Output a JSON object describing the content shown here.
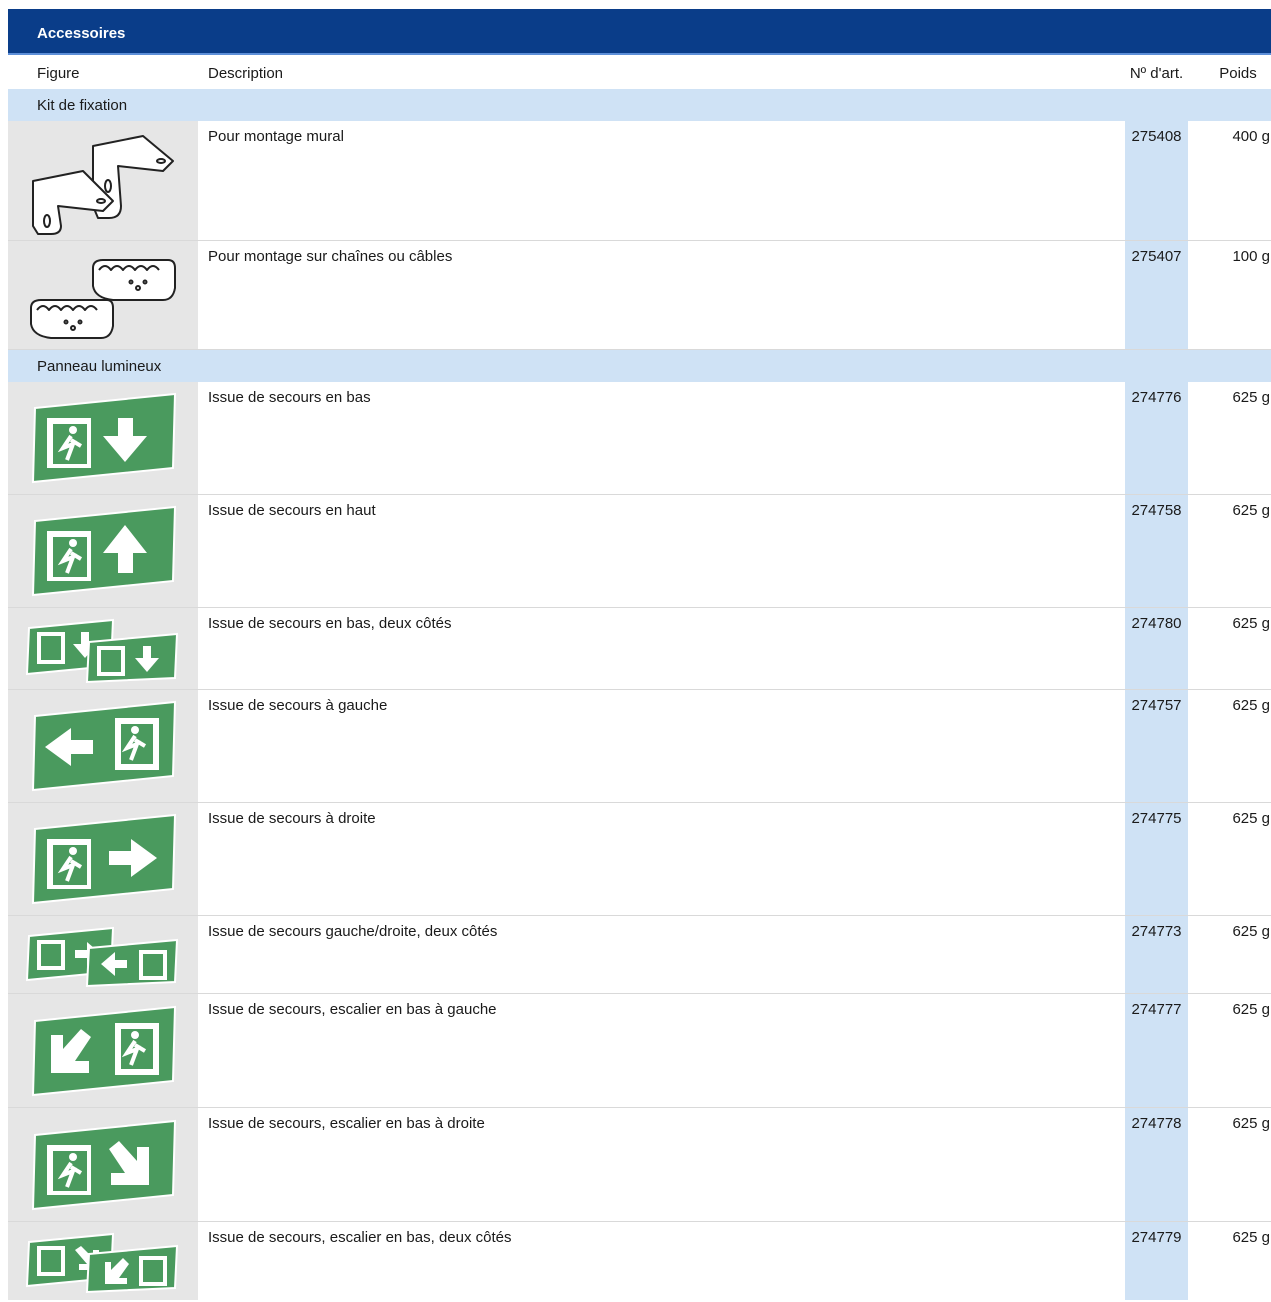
{
  "header": {
    "title": "Accessoires"
  },
  "columns": {
    "figure": "Figure",
    "description": "Description",
    "article": "Nº d'art.",
    "weight": "Poids"
  },
  "sections": [
    {
      "label": "Kit de fixation",
      "items": [
        {
          "icon": "wall-bracket-icon",
          "desc": "Pour montage mural",
          "art": "275408",
          "weight": "400 g"
        },
        {
          "icon": "chain-bracket-icon",
          "desc": "Pour montage sur chaînes ou câbles",
          "art": "275407",
          "weight": "100 g"
        }
      ]
    },
    {
      "label": "Panneau lumineux",
      "items": [
        {
          "icon": "exit-down-icon",
          "desc": "Issue de secours en bas",
          "art": "274776",
          "weight": "625 g"
        },
        {
          "icon": "exit-up-icon",
          "desc": "Issue de secours en haut",
          "art": "274758",
          "weight": "625 g"
        },
        {
          "icon": "exit-down-double-icon",
          "desc": "Issue de secours en bas, deux côtés",
          "art": "274780",
          "weight": "625 g"
        },
        {
          "icon": "exit-left-icon",
          "desc": "Issue de secours à gauche",
          "art": "274757",
          "weight": "625 g"
        },
        {
          "icon": "exit-right-icon",
          "desc": "Issue de secours à droite",
          "art": "274775",
          "weight": "625 g"
        },
        {
          "icon": "exit-left-right-double-icon",
          "desc": "Issue de secours gauche/droite, deux côtés",
          "art": "274773",
          "weight": "625 g"
        },
        {
          "icon": "exit-stairs-down-left-icon",
          "desc": "Issue de secours, escalier en bas à gauche",
          "art": "274777",
          "weight": "625 g"
        },
        {
          "icon": "exit-stairs-down-right-icon",
          "desc": "Issue de secours, escalier en bas à droite",
          "art": "274778",
          "weight": "625 g"
        },
        {
          "icon": "exit-stairs-down-double-icon",
          "desc": "Issue de secours, escalier en bas, deux côtés",
          "art": "274779",
          "weight": "625 g"
        }
      ]
    }
  ],
  "colors": {
    "title_bg": "#0a3d89",
    "section_bg": "#cfe2f5",
    "figure_bg": "#e6e6e6",
    "sign_green": "#4a9a5e"
  }
}
